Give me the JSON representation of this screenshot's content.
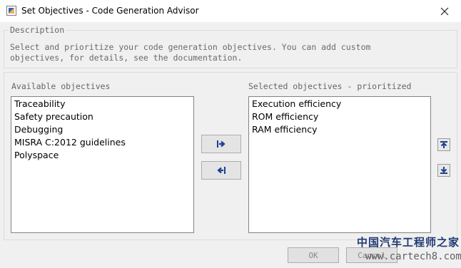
{
  "window": {
    "title": "Set Objectives - Code Generation Advisor"
  },
  "description": {
    "label": "Description",
    "text": "Select and prioritize your code generation objectives. You can add custom objectives, for details, see the documentation."
  },
  "available": {
    "label": "Available objectives",
    "items": [
      "Traceability",
      "Safety precaution",
      "Debugging",
      "MISRA C:2012 guidelines",
      "Polyspace"
    ]
  },
  "selected": {
    "label": "Selected objectives - prioritized",
    "items": [
      "Execution efficiency",
      "ROM efficiency",
      "RAM efficiency"
    ]
  },
  "buttons": {
    "ok": "OK",
    "cancel": "Cancel"
  },
  "watermark": {
    "cn": "中国汽车工程师之家",
    "url": "www.cartech8.com"
  },
  "icons": {
    "add": "arrow-right-icon",
    "remove": "arrow-left-icon",
    "up": "move-up-icon",
    "down": "move-down-icon",
    "close": "close-icon"
  },
  "colors": {
    "arrow_blue": "#1c3f8f"
  }
}
